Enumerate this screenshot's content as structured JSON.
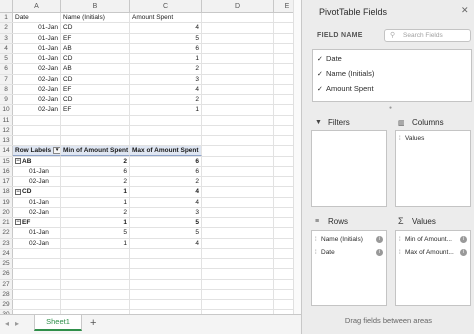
{
  "columns": [
    "A",
    "B",
    "C",
    "D",
    "E"
  ],
  "row_numbers": [
    "1",
    "2",
    "3",
    "4",
    "5",
    "6",
    "7",
    "8",
    "9",
    "10",
    "11",
    "12",
    "13",
    "14",
    "15",
    "16",
    "17",
    "18",
    "19",
    "20",
    "21",
    "22",
    "23",
    "24",
    "25",
    "26",
    "27",
    "28",
    "29",
    "30"
  ],
  "data_header": {
    "a": "Date",
    "b": "Name (Initials)",
    "c": "Amount Spent"
  },
  "data_rows": [
    {
      "date": "01-Jan",
      "name": "CD",
      "amount": "4"
    },
    {
      "date": "01-Jan",
      "name": "EF",
      "amount": "5"
    },
    {
      "date": "01-Jan",
      "name": "AB",
      "amount": "6"
    },
    {
      "date": "01-Jan",
      "name": "CD",
      "amount": "1"
    },
    {
      "date": "02-Jan",
      "name": "AB",
      "amount": "2"
    },
    {
      "date": "02-Jan",
      "name": "CD",
      "amount": "3"
    },
    {
      "date": "02-Jan",
      "name": "EF",
      "amount": "4"
    },
    {
      "date": "02-Jan",
      "name": "CD",
      "amount": "2"
    },
    {
      "date": "02-Jan",
      "name": "EF",
      "amount": "1"
    }
  ],
  "pivot_header": {
    "labels": "Row Labels",
    "min": "Min of Amount Spent",
    "max": "Max of Amount Spent",
    "filter_glyph": "▾"
  },
  "pivot_rows": [
    {
      "type": "group",
      "toggle": "−",
      "label": "AB",
      "min": "2",
      "max": "6"
    },
    {
      "type": "item",
      "label": "01-Jan",
      "min": "6",
      "max": "6"
    },
    {
      "type": "item",
      "label": "02-Jan",
      "min": "2",
      "max": "2"
    },
    {
      "type": "group",
      "toggle": "−",
      "label": "CD",
      "min": "1",
      "max": "4"
    },
    {
      "type": "item",
      "label": "01-Jan",
      "min": "1",
      "max": "4"
    },
    {
      "type": "item",
      "label": "02-Jan",
      "min": "2",
      "max": "3"
    },
    {
      "type": "group",
      "toggle": "−",
      "label": "EF",
      "min": "1",
      "max": "5"
    },
    {
      "type": "item",
      "label": "01-Jan",
      "min": "5",
      "max": "5"
    },
    {
      "type": "item",
      "label": "02-Jan",
      "min": "1",
      "max": "4"
    }
  ],
  "sheet_tab": {
    "name": "Sheet1",
    "add_glyph": "+",
    "prev_glyph": "◂",
    "next_glyph": "▸"
  },
  "pane": {
    "title": "PivotTable Fields",
    "close_glyph": "✕",
    "field_name_label": "FIELD NAME",
    "search_placeholder": "Search Fields",
    "search_icon_glyph": "⚲",
    "check_glyph": "✓",
    "fields": [
      {
        "label": "Date",
        "checked": true
      },
      {
        "label": "Name (Initials)",
        "checked": true
      },
      {
        "label": "Amount Spent",
        "checked": true
      }
    ],
    "filters": {
      "label": "Filters",
      "icon_glyph": "▼"
    },
    "columns": {
      "label": "Columns",
      "icon_glyph": "▥",
      "items": [
        "Values"
      ]
    },
    "rows": {
      "label": "Rows",
      "icon_glyph": "≡",
      "items": [
        "Name (Initials)",
        "Date"
      ]
    },
    "values": {
      "label": "Values",
      "icon_glyph": "Σ",
      "items": [
        "Min of Amount...",
        "Max of Amount..."
      ]
    },
    "grip_glyph": "⁞",
    "info_glyph": "i",
    "divider_glyph": "●",
    "drag_hint": "Drag fields between areas"
  },
  "colors": {
    "accent": "#2f8f4a",
    "pivot_header_bg": "#dfe6f2",
    "pane_bg": "#ececec"
  }
}
